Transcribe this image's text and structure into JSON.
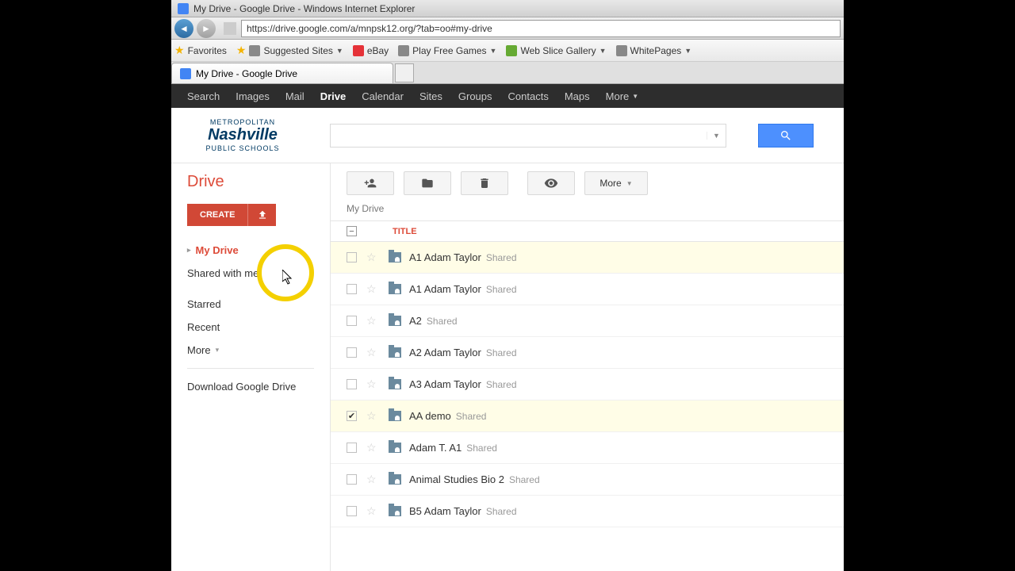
{
  "window": {
    "title": "My Drive - Google Drive - Windows Internet Explorer",
    "url": "https://drive.google.com/a/mnpsk12.org/?tab=oo#my-drive"
  },
  "favorites": {
    "label": "Favorites",
    "items": [
      "Suggested Sites",
      "eBay",
      "Play Free Games",
      "Web Slice Gallery",
      "WhitePages"
    ]
  },
  "tab": {
    "title": "My Drive - Google Drive"
  },
  "gnav": {
    "items": [
      "Search",
      "Images",
      "Mail",
      "Drive",
      "Calendar",
      "Sites",
      "Groups",
      "Contacts",
      "Maps"
    ],
    "more": "More",
    "active": "Drive"
  },
  "logo": {
    "top": "METROPOLITAN",
    "main": "Nashville",
    "sub": "PUBLIC SCHOOLS"
  },
  "sidebar": {
    "title": "Drive",
    "create": "CREATE",
    "items": [
      {
        "label": "My Drive",
        "active": true
      },
      {
        "label": "Shared with me"
      },
      {
        "label": "Starred"
      },
      {
        "label": "Recent"
      },
      {
        "label": "More",
        "dropdown": true
      }
    ],
    "download": "Download Google Drive"
  },
  "toolbar": {
    "more": "More"
  },
  "content": {
    "breadcrumb": "My Drive",
    "title_header": "TITLE",
    "files": [
      {
        "name": "A1 Adam Taylor",
        "shared": "Shared",
        "highlight": true,
        "checked": false
      },
      {
        "name": "A1 Adam Taylor",
        "shared": "Shared",
        "highlight": false,
        "checked": false
      },
      {
        "name": "A2",
        "shared": "Shared",
        "highlight": false,
        "checked": false
      },
      {
        "name": "A2 Adam Taylor",
        "shared": "Shared",
        "highlight": false,
        "checked": false
      },
      {
        "name": "A3 Adam Taylor",
        "shared": "Shared",
        "highlight": false,
        "checked": false
      },
      {
        "name": "AA demo",
        "shared": "Shared",
        "highlight": true,
        "checked": true
      },
      {
        "name": "Adam T. A1",
        "shared": "Shared",
        "highlight": false,
        "checked": false
      },
      {
        "name": "Animal Studies Bio 2",
        "shared": "Shared",
        "highlight": false,
        "checked": false
      },
      {
        "name": "B5 Adam Taylor",
        "shared": "Shared",
        "highlight": false,
        "checked": false
      }
    ]
  }
}
